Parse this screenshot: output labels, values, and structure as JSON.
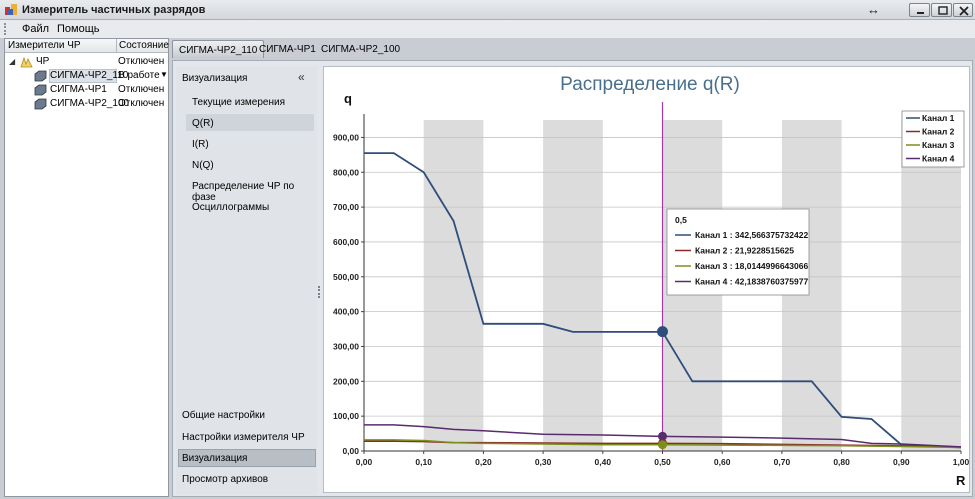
{
  "window": {
    "title": "Измеритель частичных разрядов",
    "resize_glyph": "↔",
    "icons": {
      "min": "minimize-icon",
      "max": "maximize-icon",
      "close": "close-icon"
    }
  },
  "menu": {
    "items": [
      "Файл",
      "Помощь"
    ]
  },
  "tree": {
    "header": {
      "name": "Измерители ЧР",
      "state": "Состояние"
    },
    "root": {
      "label": "ЧР",
      "state": "Отключен",
      "expander": "◢"
    },
    "children": [
      {
        "label": "СИГМА-ЧР2_110",
        "state": "В работе",
        "dropdown": "▼"
      },
      {
        "label": "СИГМА-ЧР1",
        "state": "Отключен"
      },
      {
        "label": "СИГМА-ЧР2_100",
        "state": "Отключен"
      }
    ]
  },
  "tabs": [
    "СИГМА-ЧР2_110",
    "СИГМА-ЧР1",
    "СИГМА-ЧР2_100"
  ],
  "nav": {
    "header": "Визуализация",
    "collapse_glyph": "«",
    "links": [
      "Текущие измерения",
      "Q(R)",
      "I(R)",
      "N(Q)",
      "Распределение ЧР по фазе",
      "Осциллограммы"
    ],
    "bottom": [
      "Общие настройки",
      "Настройки измерителя ЧР",
      "Визуализация",
      "Просмотр архивов"
    ]
  },
  "colors": {
    "channel1": "#2e4d7b",
    "channel2": "#8b2a2a",
    "channel3": "#7c8f1a",
    "channel4": "#5a2a6e",
    "cursor": "#a43aa4",
    "band": "#dcdcdc",
    "title": "#4a6f8c"
  },
  "chart_data": {
    "type": "line",
    "title": "Распределение  q(R)",
    "xlabel": "R",
    "ylabel": "q",
    "xlim": [
      0,
      1
    ],
    "ylim": [
      0,
      950
    ],
    "x_ticks": [
      "0,00",
      "0,10",
      "0,20",
      "0,30",
      "0,40",
      "0,50",
      "0,60",
      "0,70",
      "0,80",
      "0,90",
      "1,00"
    ],
    "y_ticks": [
      "0,00",
      "100,00",
      "200,00",
      "300,00",
      "400,00",
      "500,00",
      "600,00",
      "700,00",
      "800,00",
      "900,00"
    ],
    "grid": true,
    "legend_position": "top-right",
    "cursor_x": 0.5,
    "series": [
      {
        "name": "Канал 1",
        "color_key": "channel1",
        "x": [
          0,
          0.05,
          0.1,
          0.15,
          0.2,
          0.3,
          0.35,
          0.5,
          0.55,
          0.75,
          0.8,
          0.85,
          0.9,
          1.0
        ],
        "y": [
          855,
          855,
          800,
          660,
          365,
          365,
          342,
          342,
          200,
          200,
          98,
          92,
          18,
          10
        ]
      },
      {
        "name": "Канал 2",
        "color_key": "channel2",
        "x": [
          0,
          0.05,
          0.1,
          0.15,
          0.2,
          0.3,
          0.4,
          0.5,
          0.6,
          0.7,
          0.8,
          0.9,
          1.0
        ],
        "y": [
          28,
          28,
          27,
          24,
          24,
          23,
          22,
          22,
          21,
          19,
          17,
          15,
          12
        ]
      },
      {
        "name": "Канал 3",
        "color_key": "channel3",
        "x": [
          0,
          0.05,
          0.1,
          0.15,
          0.2,
          0.3,
          0.4,
          0.5,
          0.6,
          0.7,
          0.8,
          0.9,
          1.0
        ],
        "y": [
          32,
          32,
          30,
          24,
          22,
          20,
          18,
          18,
          17,
          16,
          15,
          13,
          10
        ]
      },
      {
        "name": "Канал 4",
        "color_key": "channel4",
        "x": [
          0,
          0.05,
          0.1,
          0.15,
          0.2,
          0.3,
          0.4,
          0.5,
          0.6,
          0.7,
          0.8,
          0.85,
          0.9,
          1.0
        ],
        "y": [
          75,
          75,
          70,
          62,
          58,
          48,
          46,
          42,
          40,
          37,
          33,
          22,
          20,
          12
        ]
      }
    ],
    "tooltip": {
      "x_label": "0,5",
      "entries": [
        "Канал 1 : 342,566375732422",
        "Канал 2 : 21,9228515625",
        "Канал 3 : 18,0144996643066",
        "Канал 4 : 42,1838760375977"
      ]
    }
  }
}
